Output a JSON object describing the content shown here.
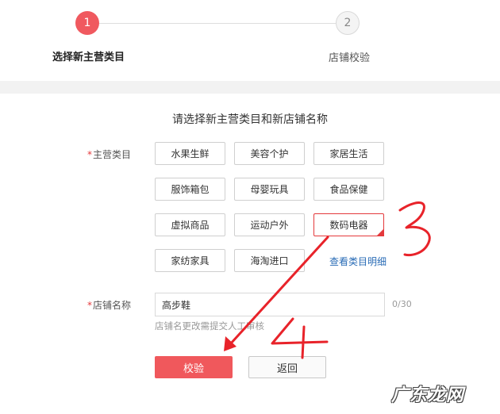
{
  "steps": [
    {
      "number": "1",
      "label": "选择新主营类目"
    },
    {
      "number": "2",
      "label": "店铺校验"
    }
  ],
  "form": {
    "title": "请选择新主营类目和新店铺名称",
    "required_mark": "*",
    "category_label": "主营类目",
    "categories": [
      "水果生鲜",
      "美容个护",
      "家居生活",
      "服饰箱包",
      "母婴玩具",
      "食品保健",
      "虚拟商品",
      "运动户外",
      "数码电器",
      "家纺家具",
      "海淘进口"
    ],
    "selected_category": "数码电器",
    "detail_link": "查看类目明细",
    "shop_name_label": "店铺名称",
    "shop_name_value": "高步鞋",
    "shop_name_counter": "0/30",
    "shop_name_hint": "店铺名更改需提交人工审核",
    "submit_button": "校验",
    "back_button": "返回"
  },
  "annotations": {
    "handwritten_3": "3",
    "handwritten_4": "4",
    "arrow_color": "#e8232a"
  },
  "watermark": "广东龙网",
  "colors": {
    "accent": "#f0595f",
    "link": "#2a6cb6",
    "required": "#e4393c"
  }
}
